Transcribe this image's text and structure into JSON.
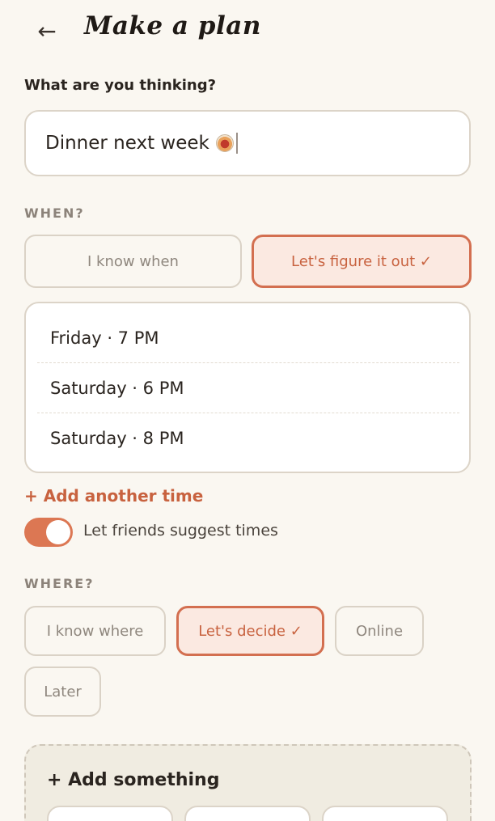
{
  "header": {
    "back_icon": "←",
    "title": "Make a plan"
  },
  "what": {
    "label": "What are you thinking?",
    "value": "Dinner next week"
  },
  "when": {
    "label": "WHEN?",
    "options": [
      "I know when",
      "Let's figure it out ✓"
    ],
    "selected_index": 1,
    "times": [
      "Friday · 7 PM",
      "Saturday · 6 PM",
      "Saturday · 8 PM"
    ],
    "add_time_label": "+ Add another time",
    "suggest_toggle": {
      "label": "Let friends suggest times",
      "on": true
    }
  },
  "where": {
    "label": "WHERE?",
    "options": [
      "I know where",
      "Let's decide ✓",
      "Online",
      "Later"
    ],
    "selected_index": 1
  },
  "add_something": {
    "label": "+ Add something"
  },
  "colors": {
    "accent": "#D36F50",
    "background": "#FAF7F1"
  }
}
